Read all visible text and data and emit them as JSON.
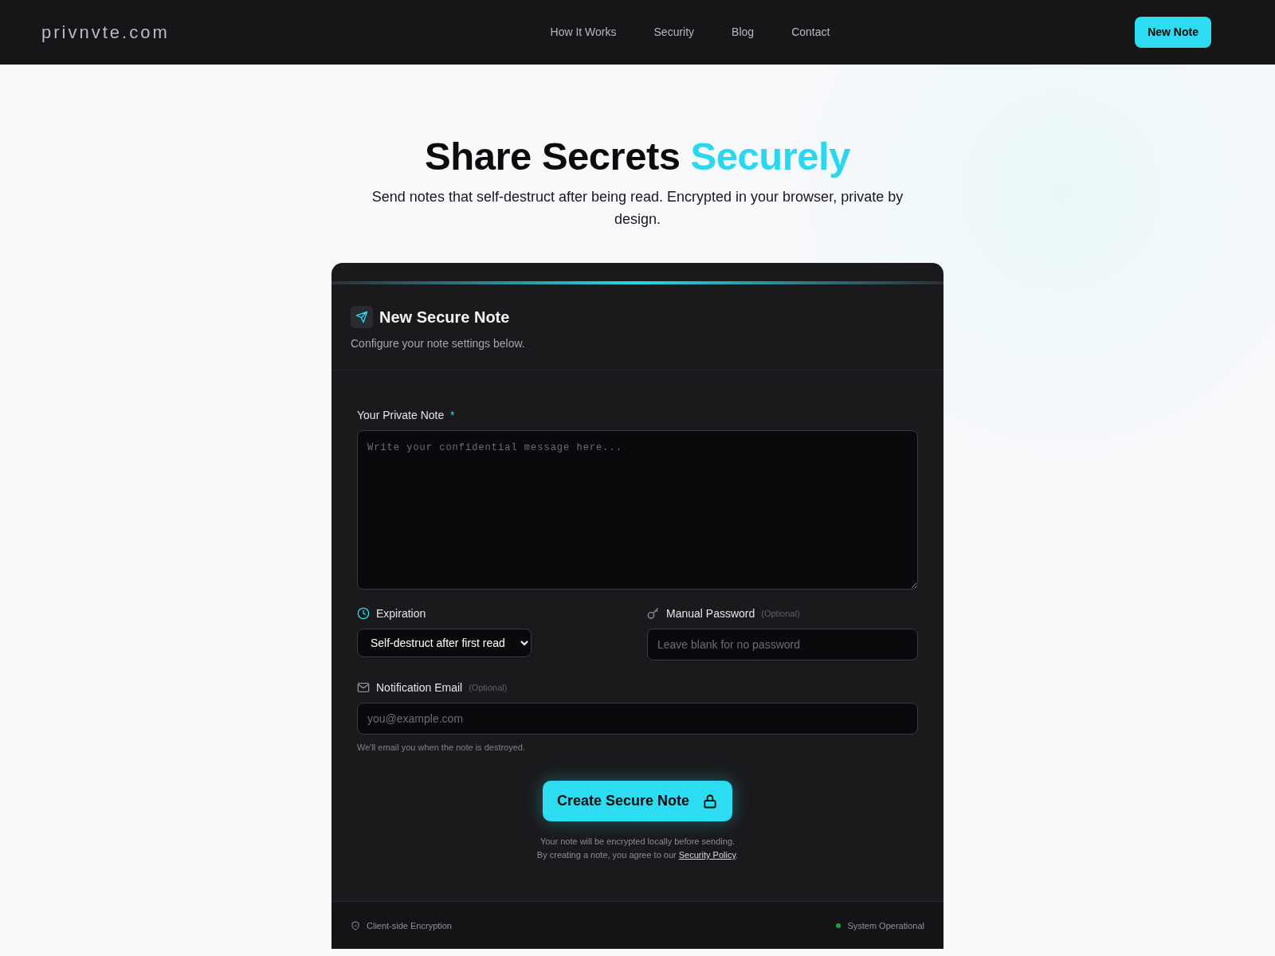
{
  "navbar": {
    "logo": "privnvte.com",
    "links": [
      {
        "label": "How It Works"
      },
      {
        "label": "Security"
      },
      {
        "label": "Blog"
      },
      {
        "label": "Contact"
      }
    ],
    "cta": "New Note"
  },
  "hero": {
    "title": "Share Secrets",
    "title_highlight": "Securely",
    "subtitle": "Send notes that self-destruct after being read. Encrypted in your browser, private by design."
  },
  "card": {
    "title": "New Secure Note",
    "subtitle": "Configure your note settings below.",
    "note": {
      "label": "Your Private Note",
      "required_mark": "*",
      "placeholder": "Write your confidential message here..."
    },
    "expiration": {
      "label": "Expiration",
      "value": "Self-destruct after first read"
    },
    "password": {
      "label": "Manual Password",
      "optional": "(Optional)",
      "placeholder": "Leave blank for no password"
    },
    "email": {
      "label": "Notification Email",
      "optional": "(Optional)",
      "placeholder": "you@example.com",
      "hint": "We'll email you when the note is destroyed."
    },
    "submit": "Create Secure Note",
    "info": "Your note will be encrypted locally before sending.",
    "agree": {
      "text": "By creating a note, you agree to our",
      "link": "Security Policy",
      "after": "."
    },
    "footer": {
      "left": "Client-side Encryption",
      "status": {
        "label": "System Operational",
        "color": "#22a04b"
      }
    }
  }
}
